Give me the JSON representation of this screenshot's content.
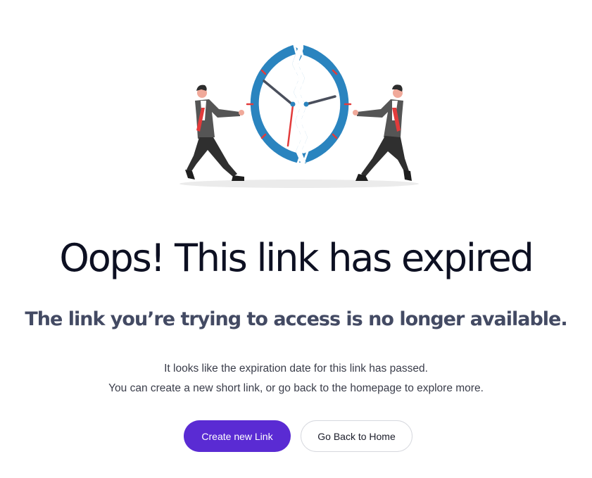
{
  "page": {
    "title": "Oops! This link has expired",
    "subtitle": "The link you’re trying to access is no longer available.",
    "description_lines": [
      "It looks like the expiration date for this link has passed.",
      "You can create a new short link, or go back to the homepage to explore more."
    ]
  },
  "actions": {
    "primary_label": "Create new Link",
    "secondary_label": "Go Back to Home"
  },
  "illustration": {
    "icon": "broken-clock-icon"
  },
  "colors": {
    "primary": "#5a2bd3",
    "title": "#0d1022",
    "subtitle": "#434a63",
    "clock_ring": "#2a84bf",
    "accent_red": "#e23b3b"
  }
}
